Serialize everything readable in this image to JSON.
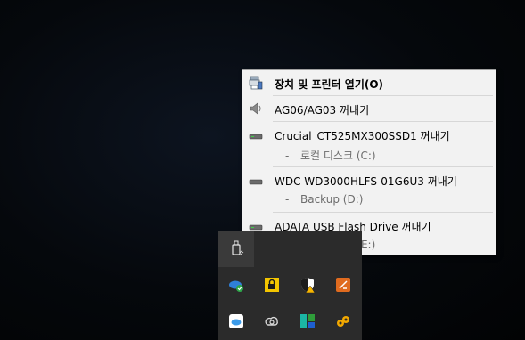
{
  "menu": {
    "items": [
      {
        "label": "장치 및 프린터 열기(O)",
        "icon": "devices-printers-icon",
        "bold": true
      },
      {
        "label": "AG06/AG03 꺼내기",
        "icon": "speaker-icon"
      },
      {
        "label": "Crucial_CT525MX300SSD1 꺼내기",
        "icon": "drive-icon",
        "sub": "로컬 디스크 (C:)"
      },
      {
        "label": "WDC WD3000HLFS-01G6U3 꺼내기",
        "icon": "drive-icon",
        "sub": "Backup (D:)"
      },
      {
        "label": "ADATA USB Flash Drive 꺼내기",
        "icon": "drive-icon",
        "sub": "UNTITLED (E:)"
      }
    ],
    "sub_prefix": "-"
  },
  "tray": {
    "icons": [
      "usb-safely-remove-icon",
      "onedrive-sync-icon",
      "lock-icon",
      "security-shield-icon",
      "sound-app-icon",
      "icloud-icon",
      "creative-cloud-icon",
      "color-tiles-icon",
      "keys-icon"
    ]
  },
  "colors": {
    "menu_bg": "#f2f2f2",
    "tray_bg": "#2b2b2b",
    "tray_highlight": "#3a3a3a"
  }
}
